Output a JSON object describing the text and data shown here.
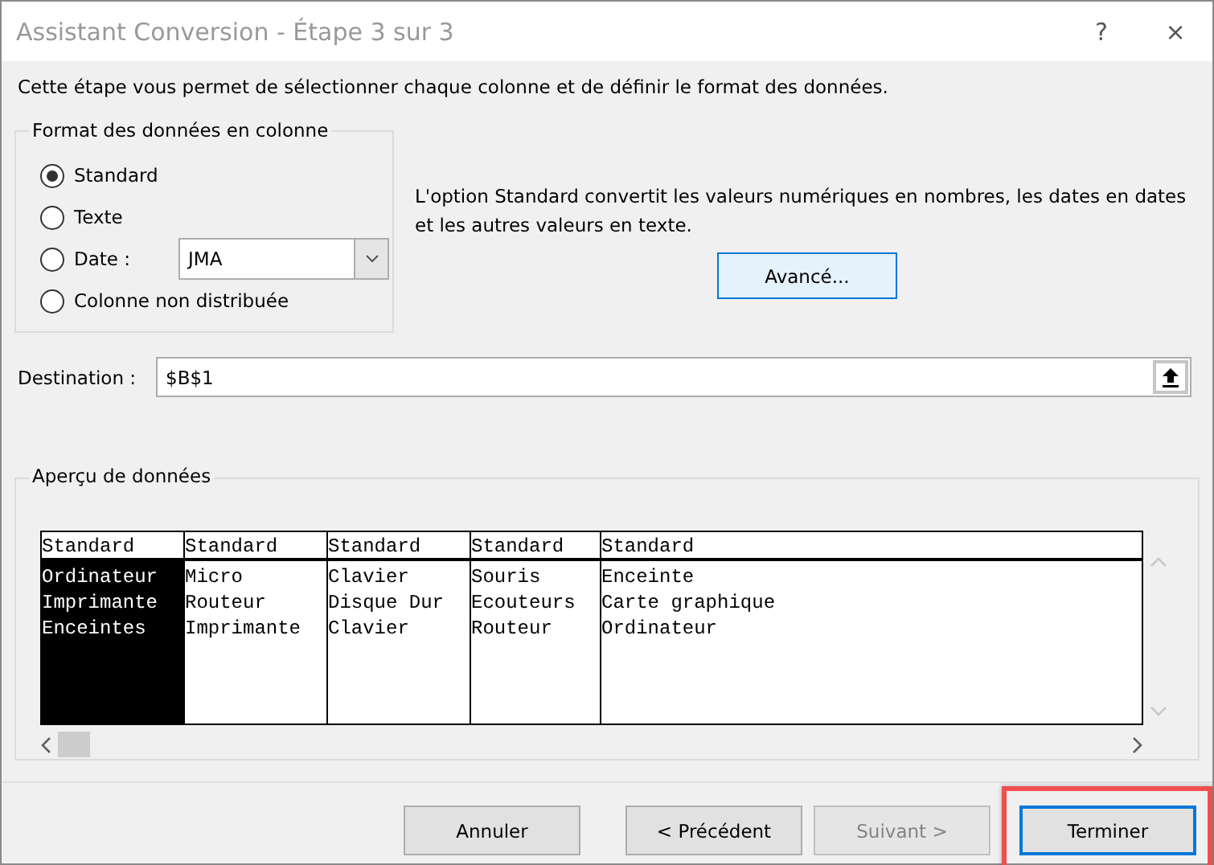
{
  "window": {
    "title": "Assistant Conversion - Étape 3 sur 3",
    "help": "?",
    "close": "×"
  },
  "intro": "Cette étape vous permet de sélectionner chaque colonne et de définir le format des données.",
  "format_group": {
    "title": "Format des données en colonne",
    "options": [
      {
        "kind": "plain",
        "label": "Standard",
        "selected": true
      },
      {
        "kind": "plain",
        "label": "Texte",
        "selected": false
      },
      {
        "kind": "combo",
        "label": "Date :",
        "selected": false,
        "value": "JMA"
      },
      {
        "kind": "plain",
        "label": "Colonne non distribuée",
        "selected": false
      }
    ]
  },
  "info": "L'option Standard convertit les valeurs numériques en nombres, les dates en dates et les autres valeurs en texte.",
  "advanced_button": "Avancé...",
  "destination": {
    "label": "Destination :",
    "value": "$B$1"
  },
  "preview": {
    "title": "Aperçu de données",
    "columns": [
      {
        "header": "Standard",
        "cells": [
          "Ordinateur",
          "Imprimante",
          "Enceintes"
        ],
        "selected": true
      },
      {
        "header": "Standard",
        "cells": [
          "Micro",
          "Routeur",
          "Imprimante"
        ],
        "selected": false
      },
      {
        "header": "Standard",
        "cells": [
          "Clavier",
          "Disque Dur",
          "Clavier"
        ],
        "selected": false
      },
      {
        "header": "Standard",
        "cells": [
          "Souris",
          "Ecouteurs",
          "Routeur"
        ],
        "selected": false
      },
      {
        "header": "Standard",
        "cells": [
          "Enceinte",
          "Carte graphique",
          "Ordinateur"
        ],
        "selected": false
      }
    ]
  },
  "buttons": [
    {
      "label": "Annuler",
      "kind": "normal",
      "highlighted": false
    },
    {
      "label": "< Précédent",
      "kind": "normal",
      "highlighted": false
    },
    {
      "label": "Suivant >",
      "kind": "disabled",
      "highlighted": false
    },
    {
      "label": "Terminer",
      "kind": "default",
      "highlighted": true
    }
  ]
}
